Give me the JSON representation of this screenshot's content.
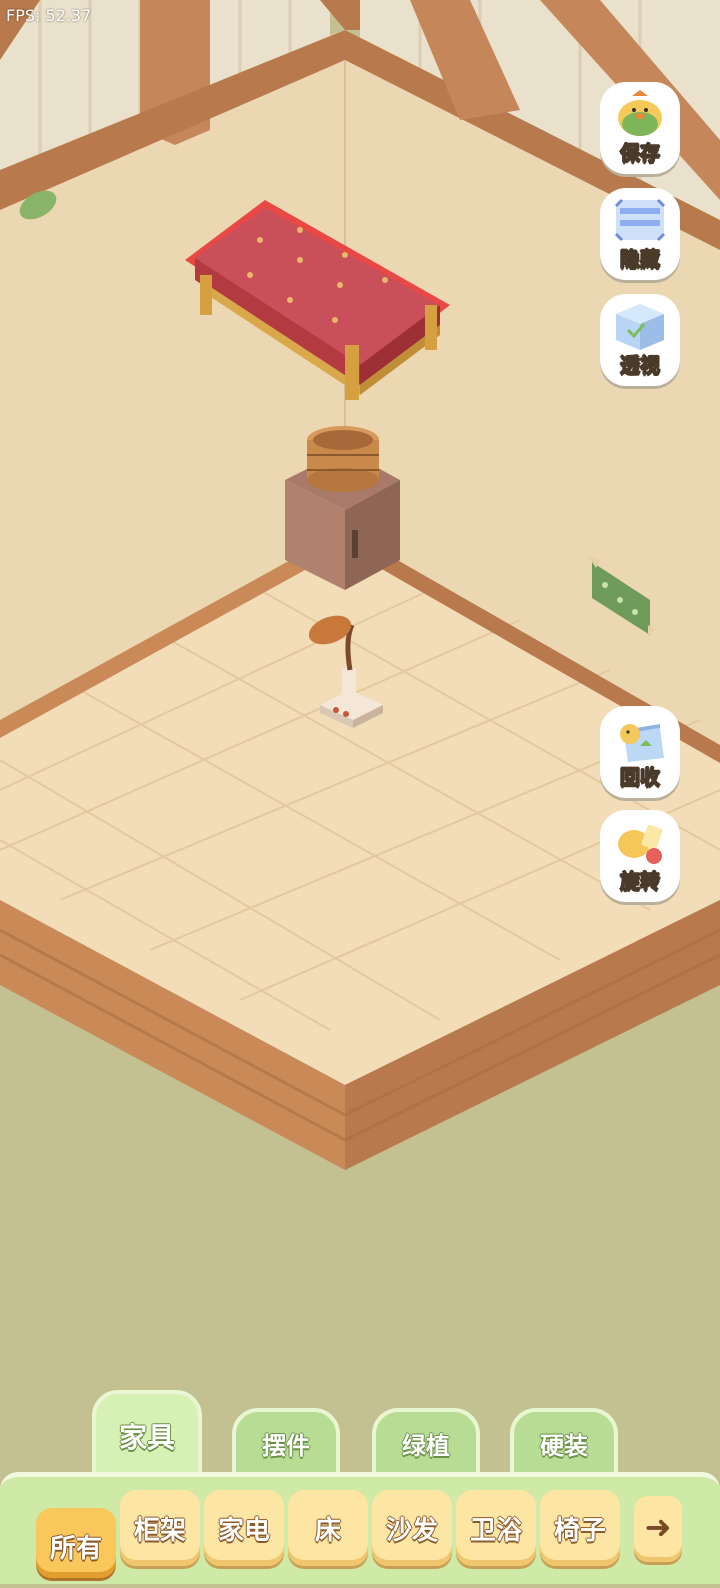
{
  "hud": {
    "fps": "FPS: 52.37"
  },
  "side_buttons": {
    "save": "保存",
    "hide": "隐藏",
    "perspective": "透视",
    "recycle": "回收",
    "rotate": "旋转"
  },
  "tabs": [
    {
      "label": "家具",
      "active": true
    },
    {
      "label": "摆件",
      "active": false
    },
    {
      "label": "绿植",
      "active": false
    },
    {
      "label": "硬装",
      "active": false
    }
  ],
  "categories": [
    {
      "label": "所有",
      "selected": true
    },
    {
      "label": "柜架"
    },
    {
      "label": "家电"
    },
    {
      "label": "床"
    },
    {
      "label": "沙发"
    },
    {
      "label": "卫浴"
    },
    {
      "label": "椅子"
    }
  ],
  "next_icon": "arrow-right-icon",
  "colors": {
    "background": "#c3c192",
    "wall": "#ecd7b3",
    "floor": "#f3dcb8",
    "wood": "#c98a58",
    "tab_green": "#b6dd93",
    "category_yellow": "#fde5a4",
    "selection_red": "#e02020"
  }
}
